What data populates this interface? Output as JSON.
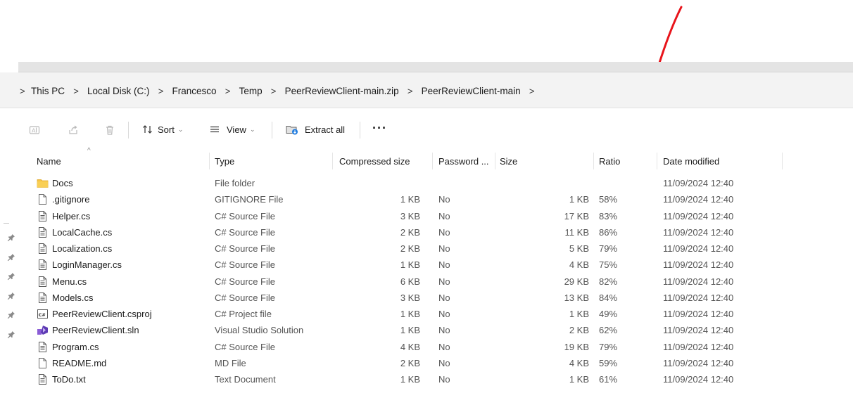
{
  "breadcrumb": {
    "items": [
      "This PC",
      "Local Disk (C:)",
      "Francesco",
      "Temp",
      "PeerReviewClient-main.zip",
      "PeerReviewClient-main"
    ],
    "separator": ">"
  },
  "toolbar": {
    "sort_label": "Sort",
    "view_label": "View",
    "extract_label": "Extract all",
    "more_label": "···"
  },
  "columns": {
    "name": "Name",
    "type": "Type",
    "compressed_size": "Compressed size",
    "password": "Password ...",
    "size": "Size",
    "ratio": "Ratio",
    "date_modified": "Date modified"
  },
  "files": [
    {
      "name": "Docs",
      "type": "File folder",
      "compressed": "",
      "password": "",
      "size": "",
      "ratio": "",
      "date": "11/09/2024 12:40",
      "icon": "folder-icon"
    },
    {
      "name": ".gitignore",
      "type": "GITIGNORE File",
      "compressed": "1 KB",
      "password": "No",
      "size": "1 KB",
      "ratio": "58%",
      "date": "11/09/2024 12:40",
      "icon": "blank-file-icon"
    },
    {
      "name": "Helper.cs",
      "type": "C# Source File",
      "compressed": "3 KB",
      "password": "No",
      "size": "17 KB",
      "ratio": "83%",
      "date": "11/09/2024 12:40",
      "icon": "text-file-icon"
    },
    {
      "name": "LocalCache.cs",
      "type": "C# Source File",
      "compressed": "2 KB",
      "password": "No",
      "size": "11 KB",
      "ratio": "86%",
      "date": "11/09/2024 12:40",
      "icon": "text-file-icon"
    },
    {
      "name": "Localization.cs",
      "type": "C# Source File",
      "compressed": "2 KB",
      "password": "No",
      "size": "5 KB",
      "ratio": "79%",
      "date": "11/09/2024 12:40",
      "icon": "text-file-icon"
    },
    {
      "name": "LoginManager.cs",
      "type": "C# Source File",
      "compressed": "1 KB",
      "password": "No",
      "size": "4 KB",
      "ratio": "75%",
      "date": "11/09/2024 12:40",
      "icon": "text-file-icon"
    },
    {
      "name": "Menu.cs",
      "type": "C# Source File",
      "compressed": "6 KB",
      "password": "No",
      "size": "29 KB",
      "ratio": "82%",
      "date": "11/09/2024 12:40",
      "icon": "text-file-icon"
    },
    {
      "name": "Models.cs",
      "type": "C# Source File",
      "compressed": "3 KB",
      "password": "No",
      "size": "13 KB",
      "ratio": "84%",
      "date": "11/09/2024 12:40",
      "icon": "text-file-icon"
    },
    {
      "name": "PeerReviewClient.csproj",
      "type": "C# Project file",
      "compressed": "1 KB",
      "password": "No",
      "size": "1 KB",
      "ratio": "49%",
      "date": "11/09/2024 12:40",
      "icon": "csproj-icon"
    },
    {
      "name": "PeerReviewClient.sln",
      "type": "Visual Studio Solution",
      "compressed": "1 KB",
      "password": "No",
      "size": "2 KB",
      "ratio": "62%",
      "date": "11/09/2024 12:40",
      "icon": "visual-studio-icon"
    },
    {
      "name": "Program.cs",
      "type": "C# Source File",
      "compressed": "4 KB",
      "password": "No",
      "size": "19 KB",
      "ratio": "79%",
      "date": "11/09/2024 12:40",
      "icon": "text-file-icon"
    },
    {
      "name": "README.md",
      "type": "MD File",
      "compressed": "2 KB",
      "password": "No",
      "size": "4 KB",
      "ratio": "59%",
      "date": "11/09/2024 12:40",
      "icon": "blank-file-icon"
    },
    {
      "name": "ToDo.txt",
      "type": "Text Document",
      "compressed": "1 KB",
      "password": "No",
      "size": "1 KB",
      "ratio": "61%",
      "date": "11/09/2024 12:40",
      "icon": "text-file-icon"
    }
  ],
  "colors": {
    "annotation_arrow": "#e8141b",
    "folder": "#f6c343",
    "address_bar_bg": "#f3f3f3"
  }
}
